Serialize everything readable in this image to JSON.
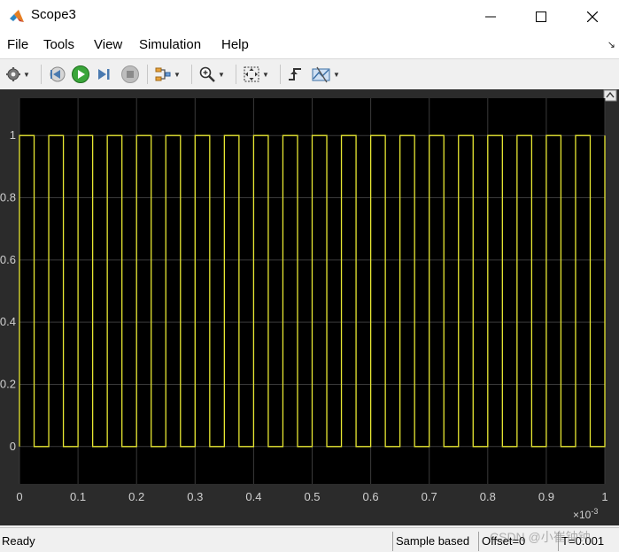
{
  "window": {
    "title": "Scope3"
  },
  "menu": {
    "items": [
      "File",
      "Tools",
      "View",
      "Simulation",
      "Help"
    ]
  },
  "toolbar": {
    "icons": [
      "gear-icon",
      "step-back-icon",
      "run-icon",
      "step-forward-icon",
      "stop-icon",
      "signal-icon",
      "zoom-in-icon",
      "fit-to-view-icon",
      "trigger-icon",
      "cursor-measure-icon"
    ]
  },
  "colors": {
    "signal": "#e8e832",
    "plot_background": "#000000",
    "figure_background": "#2b2b2b",
    "grid": "#3a3a3a",
    "tick_label": "#d0d0d0"
  },
  "chart_data": {
    "type": "line",
    "title": "",
    "xlabel": "",
    "ylabel": "",
    "x_exponent_label": "×10",
    "x_exponent_power": "-3",
    "xlim": [
      0,
      1
    ],
    "ylim": [
      -0.12,
      1.12
    ],
    "xticks": [
      "0",
      "0.1",
      "0.2",
      "0.3",
      "0.4",
      "0.5",
      "0.6",
      "0.7",
      "0.8",
      "0.9",
      "1"
    ],
    "yticks": [
      "0",
      "0.2",
      "0.4",
      "0.6",
      "0.8",
      "1"
    ],
    "grid": true,
    "series": [
      {
        "period": 0.05,
        "duty_cycle": 0.5,
        "low": 0,
        "high": 1,
        "first_high": 0.0,
        "description_points": "square wave 0→1, period 0.05 (×10^-3 s)"
      }
    ]
  },
  "status": {
    "ready": "Ready",
    "sample_mode": "Sample based",
    "offset": "Offset=0",
    "time": "T=0.001"
  },
  "watermark": "CSDN @小崔钟钟"
}
